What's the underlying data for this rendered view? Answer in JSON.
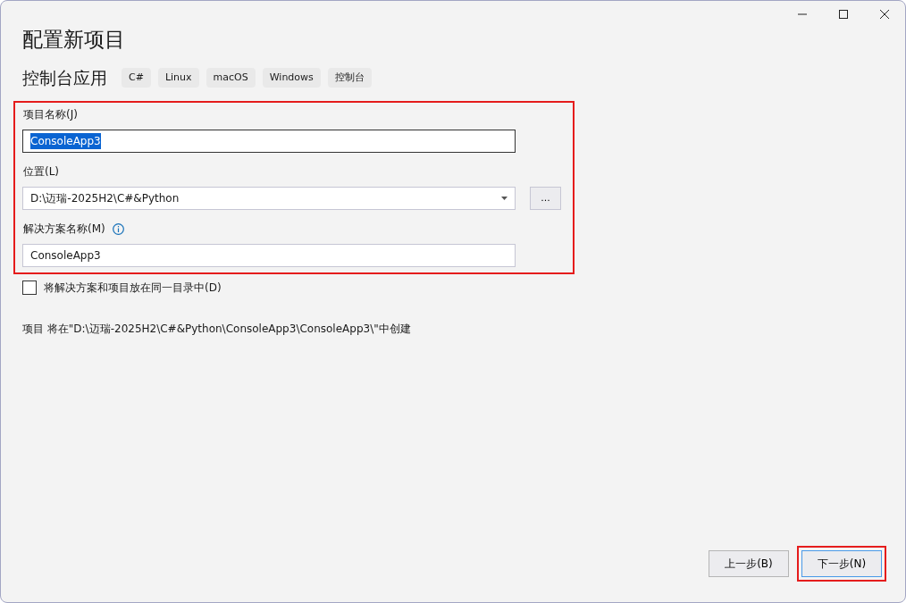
{
  "window": {
    "title": "配置新项目"
  },
  "template": {
    "name": "控制台应用",
    "tags": [
      "C#",
      "Linux",
      "macOS",
      "Windows",
      "控制台"
    ]
  },
  "form": {
    "highlighted": true,
    "fields": [
      {
        "kind": "text",
        "label": "项目名称(J)",
        "value": "ConsoleApp3",
        "selected": true,
        "info": false
      },
      {
        "kind": "combo",
        "label": "位置(L)",
        "value": "D:\\迈瑞-2025H2\\C#&Python",
        "browse": "...",
        "selected": false,
        "info": false
      },
      {
        "kind": "text",
        "label": "解决方案名称(M)",
        "value": "ConsoleApp3",
        "selected": false,
        "info": true
      }
    ]
  },
  "same_dir": {
    "label": "将解决方案和项目放在同一目录中(D)",
    "checked": false
  },
  "path_note": "项目 将在\"D:\\迈瑞-2025H2\\C#&Python\\ConsoleApp3\\ConsoleApp3\\\"中创建",
  "buttons": [
    {
      "label": "上一步(B)",
      "default": false,
      "highlighted": false
    },
    {
      "label": "下一步(N)",
      "default": true,
      "highlighted": true
    }
  ]
}
